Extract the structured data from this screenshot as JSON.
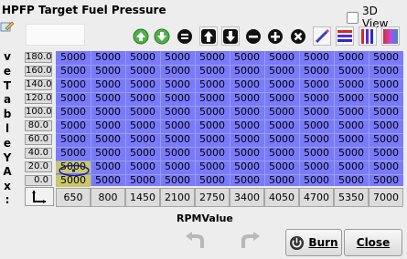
{
  "title": "HPFP Target Fuel Pressure",
  "view3d": {
    "label": "3D View",
    "checked": false
  },
  "y_axis_label": [
    "v",
    "e",
    "T",
    "a",
    "b",
    "l",
    "e",
    "Y",
    "A",
    "x",
    ":"
  ],
  "row_headers": [
    "180.0",
    "160.0",
    "140.0",
    "120.0",
    "100.0",
    "80.0",
    "60.0",
    "40.0",
    "20.0",
    "0.0"
  ],
  "col_headers": [
    "650",
    "800",
    "1450",
    "2100",
    "2750",
    "3400",
    "4050",
    "4700",
    "5350",
    "7000"
  ],
  "cell_value": "5000",
  "x_axis_label": "RPMValue",
  "buttons": {
    "burn": "Burn",
    "close": "Close"
  },
  "toolbar_icons": [
    "increment-icon",
    "decrement-icon",
    "equals-icon",
    "up-arrow-icon",
    "down-arrow-icon",
    "minus-icon",
    "plus-icon",
    "multiply-icon",
    "pencil-icon",
    "horizontal-lines-icon",
    "vertical-lines-icon",
    "gradient-icon"
  ]
}
